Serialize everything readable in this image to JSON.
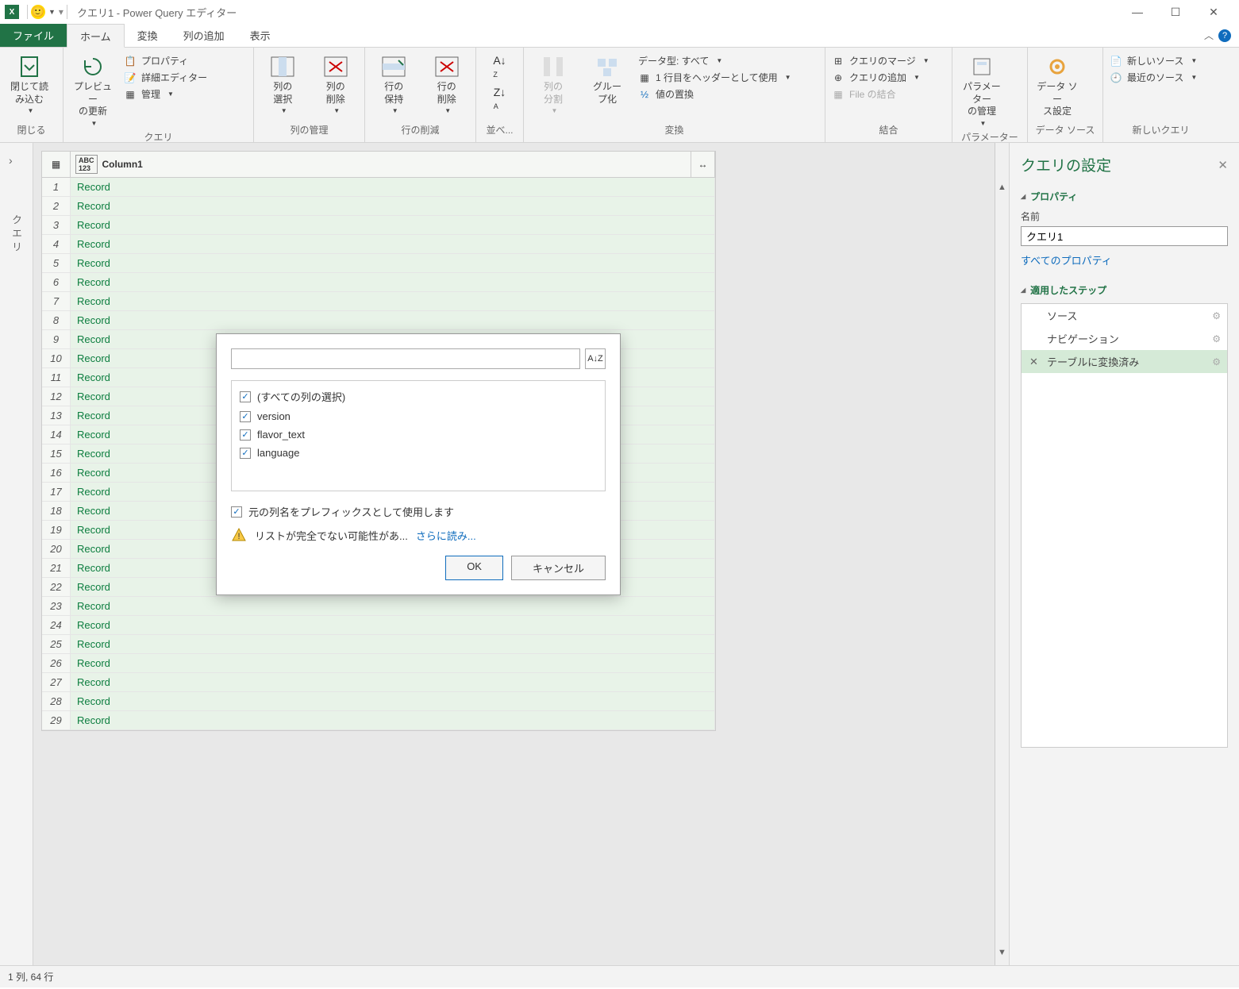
{
  "title": "クエリ1 - Power Query エディター",
  "tabs": {
    "file": "ファイル",
    "home": "ホーム",
    "transform": "変換",
    "addcol": "列の追加",
    "view": "表示"
  },
  "ribbon": {
    "close": {
      "btn": "閉じて読\nみ込む",
      "group": "閉じる"
    },
    "query": {
      "refresh": "プレビュー\nの更新",
      "props": "プロパティ",
      "adv": "詳細エディター",
      "manage": "管理",
      "group": "クエリ"
    },
    "cols": {
      "choose": "列の\n選択",
      "remove": "列の\n削除",
      "group": "列の管理"
    },
    "rows": {
      "keep": "行の\n保持",
      "remove": "行の\n削除",
      "group": "行の削減"
    },
    "sort": {
      "group": "並べ..."
    },
    "transform2": {
      "split": "列の\n分割",
      "groupby": "グルー\nプ化",
      "dtype": "データ型: すべて",
      "headers": "1 行目をヘッダーとして使用",
      "replace": "値の置換",
      "group": "変換"
    },
    "combine": {
      "merge": "クエリのマージ",
      "append": "クエリの追加",
      "combinefiles": "File の結合",
      "group": "結合"
    },
    "params": {
      "btn": "パラメーター\nの管理",
      "group": "パラメーター"
    },
    "datasource": {
      "btn": "データ ソー\nス設定",
      "group": "データ ソース"
    },
    "newquery": {
      "new": "新しいソース",
      "recent": "最近のソース",
      "group": "新しいクエリ"
    }
  },
  "left_rail": "クエリ",
  "grid": {
    "col_header": "Column1",
    "cell_value": "Record",
    "rows": [
      1,
      2,
      3,
      4,
      5,
      6,
      7,
      8,
      9,
      10,
      11,
      12,
      13,
      14,
      15,
      16,
      17,
      18,
      19,
      20,
      21,
      22,
      23,
      24,
      25,
      26,
      27,
      28,
      29
    ]
  },
  "dialog": {
    "sort_label": "A↓Z",
    "select_all": "(すべての列の選択)",
    "items": [
      "version",
      "flavor_text",
      "language"
    ],
    "prefix_opt": "元の列名をプレフィックスとして使用します",
    "warning": "リストが完全でない可能性があ...",
    "more": "さらに読み...",
    "ok": "OK",
    "cancel": "キャンセル"
  },
  "settings": {
    "title": "クエリの設定",
    "props_title": "プロパティ",
    "name_label": "名前",
    "name_value": "クエリ1",
    "all_props": "すべてのプロパティ",
    "steps_title": "適用したステップ",
    "steps": [
      "ソース",
      "ナビゲーション",
      "テーブルに変換済み"
    ]
  },
  "status": "1 列, 64 行"
}
